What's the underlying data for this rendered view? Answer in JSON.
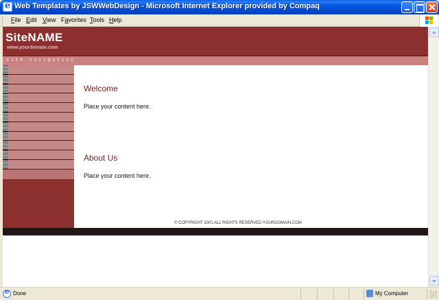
{
  "window": {
    "title": "Web Templates by JSWWebDesign - Microsoft Internet Explorer provided by Compaq"
  },
  "menu": [
    {
      "prefix": "",
      "accel": "F",
      "rest": "ile"
    },
    {
      "prefix": "",
      "accel": "E",
      "rest": "dit"
    },
    {
      "prefix": "",
      "accel": "V",
      "rest": "iew"
    },
    {
      "prefix": "F",
      "accel": "a",
      "rest": "vorites"
    },
    {
      "prefix": "",
      "accel": "T",
      "rest": "ools"
    },
    {
      "prefix": "",
      "accel": "H",
      "rest": "elp"
    }
  ],
  "site": {
    "name": "SiteNAME",
    "domain": "www.yourdomain.com",
    "nav_label": "site navigation",
    "nav_items_count": 11
  },
  "content": {
    "sections": [
      {
        "heading": "Welcome",
        "text": "Place your content here."
      },
      {
        "heading": "About Us",
        "text": "Place your content here."
      }
    ],
    "copyright": "© COPYRIGHT 2001 ALL RIGHTS RESERVED YOURDOMAIN.COM"
  },
  "status": {
    "text": "Done",
    "zone": "My Computer"
  },
  "colors": {
    "brand": "#8b2f2f",
    "nav_item": "#c58888",
    "heading": "#7a2020"
  },
  "icons": {
    "app": "ie-icon",
    "minimize": "minimize-icon",
    "maximize": "maximize-icon",
    "close": "close-icon",
    "windows_logo": "windows-logo-icon",
    "status": "ie-page-icon",
    "zone": "computer-icon"
  }
}
